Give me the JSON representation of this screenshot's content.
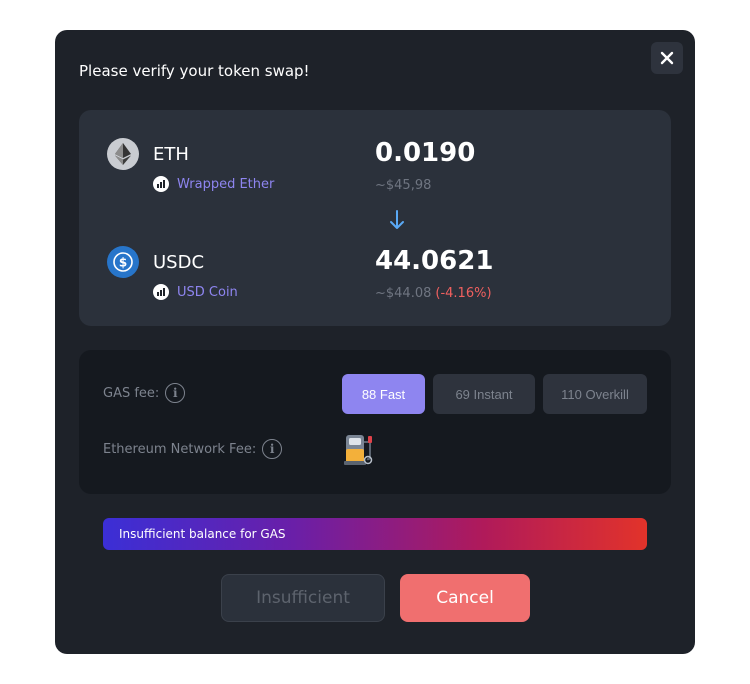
{
  "modal": {
    "title": "Please verify your token swap!",
    "close_icon": "close-icon"
  },
  "from_token": {
    "symbol": "ETH",
    "name": "Wrapped Ether",
    "amount": "0.0190",
    "usd_value": "~$45,98",
    "icon": "eth-icon"
  },
  "swap_direction_icon": "arrow-down-icon",
  "to_token": {
    "symbol": "USDC",
    "name": "USD Coin",
    "amount": "44.0621",
    "usd_value": "~$44.08",
    "price_impact": "(-4.16%)",
    "icon": "usdc-icon"
  },
  "gas": {
    "label": "GAS fee:",
    "options": [
      {
        "label": "88 Fast",
        "active": true
      },
      {
        "label": "69 Instant",
        "active": false
      },
      {
        "label": "110 Overkill",
        "active": false
      }
    ],
    "network_fee_label": "Ethereum Network Fee:",
    "network_fee_icon": "gas-pump-icon"
  },
  "warning": {
    "text": "Insufficient balance for GAS"
  },
  "actions": {
    "confirm_label": "Insufficient",
    "cancel_label": "Cancel"
  },
  "colors": {
    "accent": "#8e85f0",
    "danger": "#f06f6f",
    "background": "#1e2229"
  }
}
